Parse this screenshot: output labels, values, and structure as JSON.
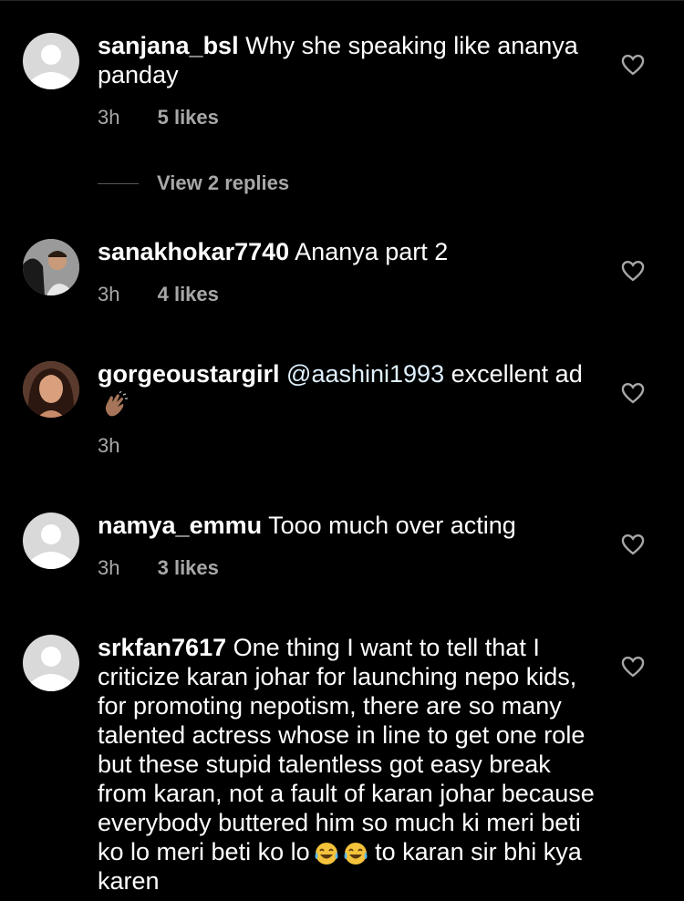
{
  "comments": [
    {
      "username": "sanjana_bsl",
      "text": "Why she speaking like ananya panday",
      "time": "3h",
      "likes": "5 likes",
      "replies": "View 2 replies"
    },
    {
      "username": "sanakhokar7740",
      "text": "Ananya part 2",
      "time": "3h",
      "likes": "4 likes"
    },
    {
      "username": "gorgeoustargirl",
      "mention": "@aashini1993",
      "text": "excellent ad",
      "time": "3h"
    },
    {
      "username": "namya_emmu",
      "text": "Tooo much over acting",
      "time": "3h",
      "likes": "3 likes"
    },
    {
      "username": "srkfan7617",
      "text": "One thing I want to tell that I criticize karan johar for launching nepo kids, for promoting nepotism, there are so many talented actress whose in line to get one role but these stupid talentless got easy break from karan, not a fault of karan johar because everybody buttered him so much ki meri beti ko lo meri beti ko lo",
      "text_after_emoji": "to karan sir bhi kya karen"
    }
  ],
  "colors": {
    "background": "#000000",
    "text": "#ffffff",
    "secondary": "#a8a8a8",
    "mention": "#e0f1ff",
    "avatar_placeholder": "#d9d9d9"
  },
  "icons": {
    "like": "heart-outline-icon",
    "clap": "clapping-hands-emoji",
    "laugh": "tears-of-joy-emoji"
  }
}
